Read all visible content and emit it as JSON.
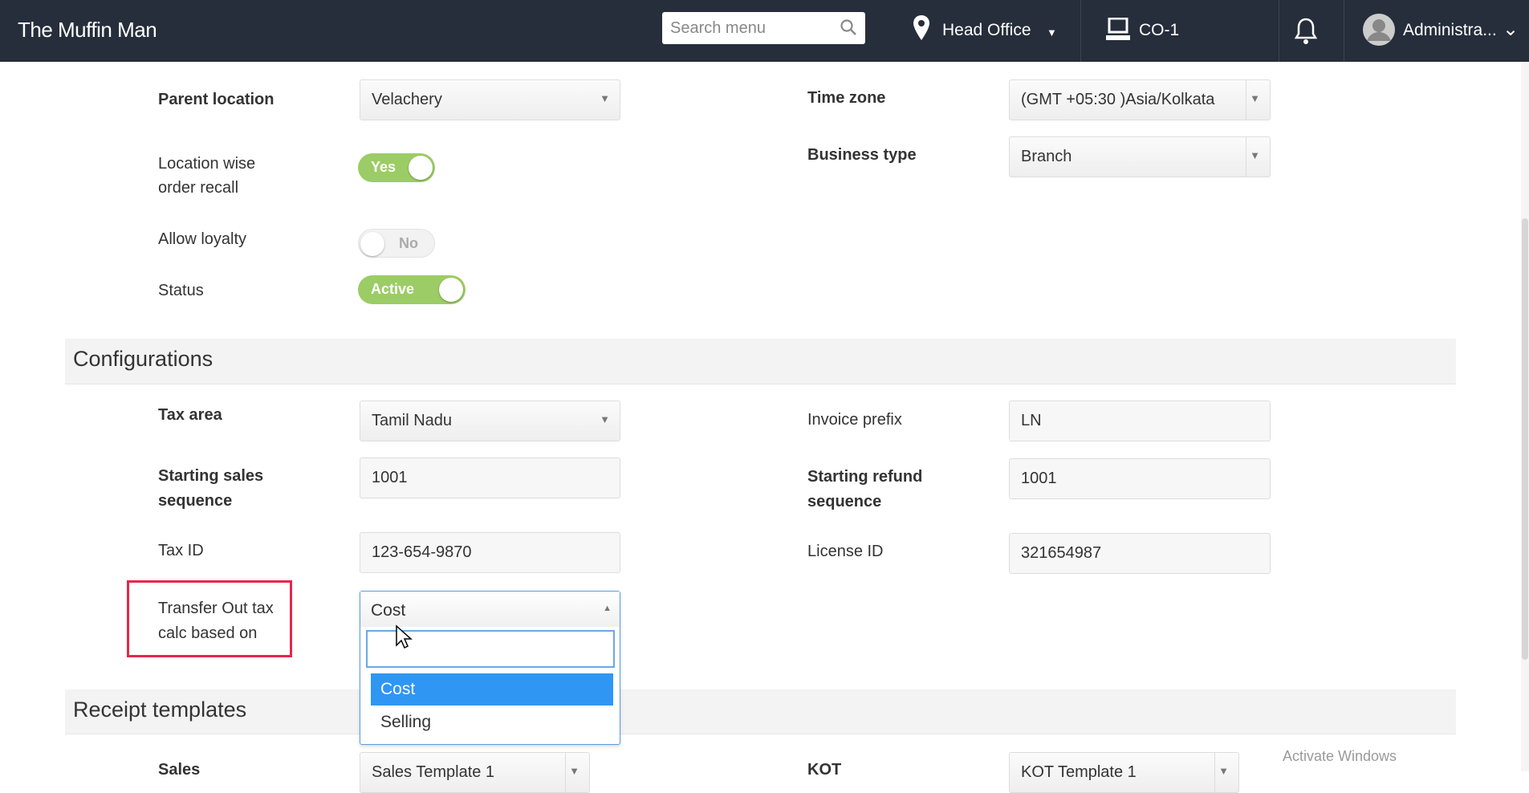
{
  "header": {
    "brand": "The Muffin Man",
    "search_placeholder": "Search menu",
    "location": "Head Office",
    "register": "CO-1",
    "user": "Administra..."
  },
  "general": {
    "parent_location": {
      "label": "Parent location",
      "value": "Velachery"
    },
    "time_zone": {
      "label": "Time zone",
      "value": "(GMT +05:30 )Asia/Kolkata"
    },
    "location_wise_recall": {
      "label_line1": "Location wise",
      "label_line2": "order recall",
      "value": "Yes",
      "on": true
    },
    "business_type": {
      "label": "Business type",
      "value": "Branch"
    },
    "allow_loyalty": {
      "label": "Allow loyalty",
      "value": "No",
      "on": false
    },
    "status": {
      "label": "Status",
      "value": "Active",
      "on": true
    }
  },
  "configurations": {
    "title": "Configurations",
    "tax_area": {
      "label": "Tax area",
      "value": "Tamil Nadu"
    },
    "invoice_prefix": {
      "label": "Invoice prefix",
      "value": "LN"
    },
    "starting_sales": {
      "label_line1": "Starting sales",
      "label_line2": "sequence",
      "value": "1001"
    },
    "starting_refund": {
      "label_line1": "Starting refund",
      "label_line2": "sequence",
      "value": "1001"
    },
    "tax_id": {
      "label": "Tax ID",
      "value": "123-654-9870"
    },
    "license_id": {
      "label": "License ID",
      "value": "321654987"
    },
    "transfer_out": {
      "label_line1": "Transfer Out tax",
      "label_line2": "calc based on",
      "value": "Cost",
      "search": "",
      "options": [
        "Cost",
        "Selling"
      ]
    }
  },
  "receipt_templates": {
    "title": "Receipt templates",
    "sales_label": "Sales",
    "sales_value": "Sales Template 1",
    "kot_label": "KOT",
    "kot_value": "KOT Template 1"
  },
  "watermark": "Activate Windows"
}
